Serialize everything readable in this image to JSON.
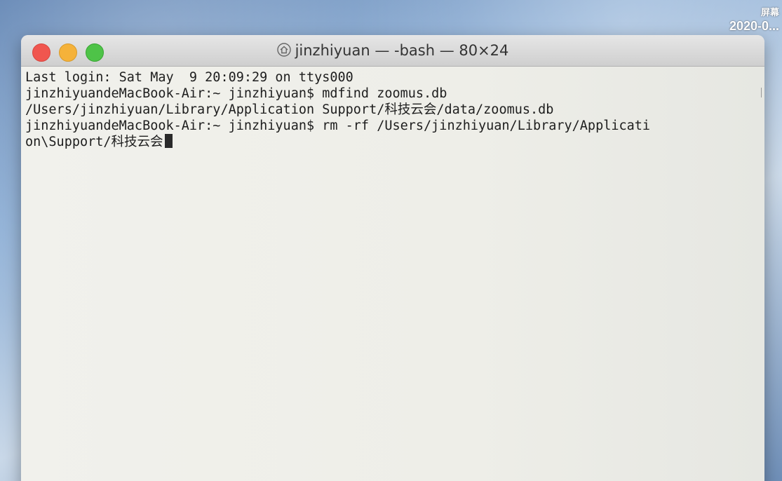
{
  "desktop": {
    "corner_line1": "屏幕",
    "corner_line2": "2020-0..."
  },
  "window": {
    "title": "jinzhiyuan — -bash — 80×24",
    "title_icon": "home-icon",
    "buttons": {
      "close_color": "#f0564f",
      "minimize_color": "#f5b23a",
      "maximize_color": "#4ec348"
    }
  },
  "terminal": {
    "lines": [
      "Last login: Sat May  9 20:09:29 on ttys000",
      "jinzhiyuandeMacBook-Air:~ jinzhiyuan$ mdfind zoomus.db",
      "/Users/jinzhiyuan/Library/Application Support/科技云会/data/zoomus.db",
      "jinzhiyuandeMacBook-Air:~ jinzhiyuan$ rm -rf /Users/jinzhiyuan/Library/Applicati",
      "on\\Support/科技云会"
    ]
  }
}
